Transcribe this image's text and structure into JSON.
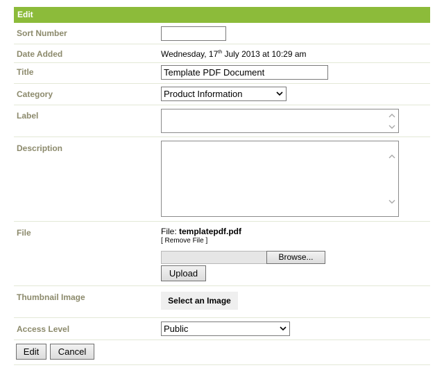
{
  "header": {
    "title": "Edit"
  },
  "form": {
    "sort_number": {
      "label": "Sort Number",
      "value": ""
    },
    "date_added": {
      "label": "Date Added",
      "day": "Wednesday, 17",
      "suffix": "th",
      "rest": " July 2013 at 10:29 am"
    },
    "title": {
      "label": "Title",
      "value": "Template PDF Document"
    },
    "category": {
      "label": "Category",
      "selected": "Product Information"
    },
    "label_field": {
      "label": "Label",
      "value": ""
    },
    "description": {
      "label": "Description",
      "value": ""
    },
    "file": {
      "label": "File",
      "prefix": "File: ",
      "name": "templatepdf.pdf",
      "remove": "[ Remove File ]",
      "browse": "Browse...",
      "upload": "Upload"
    },
    "thumbnail": {
      "label": "Thumbnail Image",
      "button": "Select an Image"
    },
    "access_level": {
      "label": "Access Level",
      "selected": "Public"
    }
  },
  "actions": {
    "edit": "Edit",
    "cancel": "Cancel"
  },
  "colors": {
    "header_bg": "#8cbb3a",
    "label_text": "#8c8a6c"
  }
}
